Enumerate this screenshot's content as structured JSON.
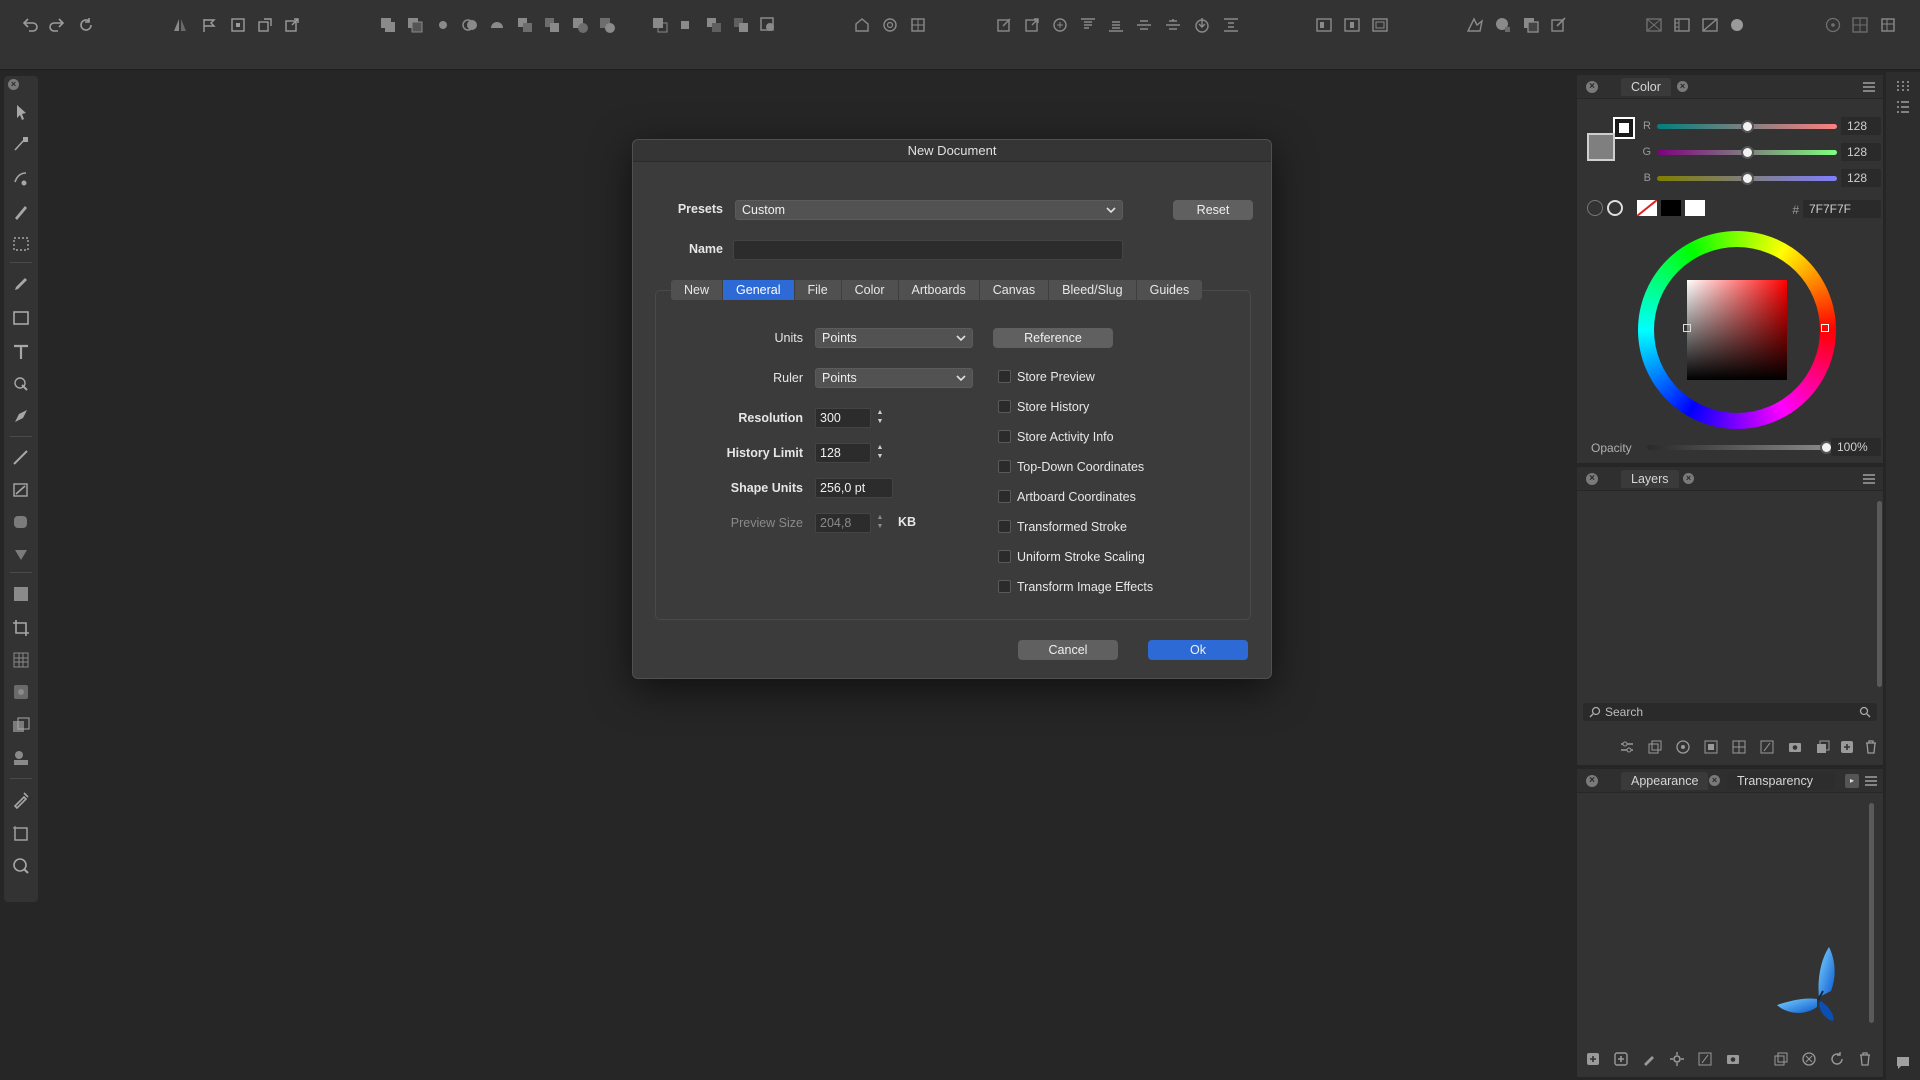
{
  "colors": {
    "accent": "#2d6ad6",
    "background": "#262626",
    "panel": "#333333"
  },
  "toolbar_icons": [
    "undo-icon",
    "redo-icon",
    "refresh-icon",
    "flip-icon",
    "flag-icon",
    "transform-icon",
    "rotate-icon",
    "export-icon",
    "boolean-add-icon",
    "boolean-subtract-icon",
    "boolean-intersect-icon",
    "boolean-xor-icon",
    "boolean-divide-icon",
    "arrange-icon",
    "order-icon",
    "forward-icon",
    "backward-icon",
    "group-icon",
    "ungroup-icon",
    "align-left-icon",
    "align-center-icon",
    "distribute-icon",
    "snap-icon",
    "grid-icon",
    "guides-icon",
    "edit-icon",
    "open-icon",
    "target-icon",
    "align-top-icon",
    "align-middle-icon",
    "align-bottom-icon",
    "distribute-h-icon",
    "download-icon",
    "distribute-v-icon",
    "view-mode-icon",
    "preview-icon",
    "outline-icon",
    "persona-vector-icon",
    "persona-pixel-icon",
    "persona-export-icon",
    "persona-edit-icon",
    "layout-icon",
    "panels-icon",
    "split-icon",
    "record-icon",
    "assistant-icon",
    "snapping-icon",
    "settings-icon"
  ],
  "tool_icons": [
    "move-tool-icon",
    "node-tool-icon",
    "pen-tool-icon",
    "brush-tool-icon",
    "marquee-tool-icon",
    "pencil-tool-icon",
    "rectangle-tool-icon",
    "text-tool-icon",
    "fill-tool-icon",
    "vector-brush-icon",
    "pixel-brush-icon",
    "eraser-icon",
    "shape-icon",
    "blur-icon",
    "gradient-tool-icon",
    "crop-tool-icon",
    "mesh-tool-icon",
    "transparency-tool-icon",
    "place-image-icon",
    "stamp-icon",
    "eyedropper-icon",
    "artboard-tool-icon",
    "zoom-tool-icon"
  ],
  "dialog": {
    "title": "New Document",
    "presets_label": "Presets",
    "presets_value": "Custom",
    "reset_label": "Reset",
    "name_label": "Name",
    "name_value": "",
    "tabs": [
      "New",
      "General",
      "File",
      "Color",
      "Artboards",
      "Canvas",
      "Bleed/Slug",
      "Guides"
    ],
    "active_tab": "General",
    "units_label": "Units",
    "units_value": "Points",
    "reference_label": "Reference",
    "ruler_label": "Ruler",
    "ruler_value": "Points",
    "resolution_label": "Resolution",
    "resolution_value": "300",
    "history_label": "History Limit",
    "history_value": "128",
    "shape_units_label": "Shape Units",
    "shape_units_value": "256,0 pt",
    "preview_size_label": "Preview Size",
    "preview_size_value": "204,8",
    "preview_size_unit": "KB",
    "checkboxes": [
      "Store Preview",
      "Store History",
      "Store Activity Info",
      "Top-Down Coordinates",
      "Artboard Coordinates",
      "Transformed Stroke",
      "Uniform Stroke Scaling",
      "Transform Image Effects"
    ],
    "cancel_label": "Cancel",
    "ok_label": "Ok"
  },
  "color_panel": {
    "tab": "Color",
    "r_label": "R",
    "r_value": "128",
    "g_label": "G",
    "g_value": "128",
    "b_label": "B",
    "b_value": "128",
    "hex_label": "#",
    "hex_value": "7F7F7F",
    "opacity_label": "Opacity",
    "opacity_value": "100%",
    "fill_color": "#7f7f7f"
  },
  "layers_panel": {
    "tab": "Layers",
    "search_placeholder": "Search"
  },
  "appearance_panel": {
    "tab_appearance": "Appearance",
    "tab_transparency": "Transparency"
  }
}
